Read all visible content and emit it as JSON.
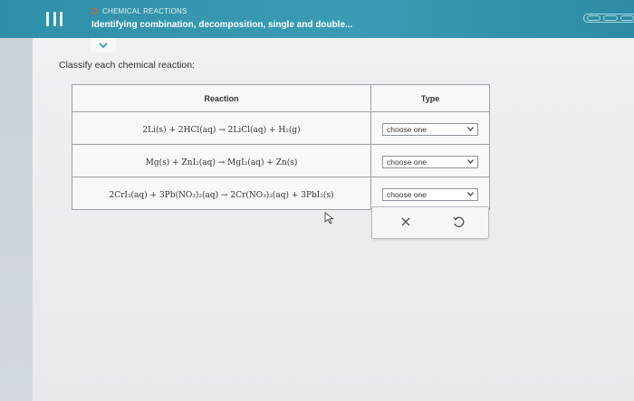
{
  "header": {
    "topic": "CHEMICAL REACTIONS",
    "title": "Identifying combination, decomposition, single and double..."
  },
  "prompt": "Classify each chemical reaction:",
  "table": {
    "headers": {
      "reaction": "Reaction",
      "type": "Type"
    },
    "rows": [
      {
        "reaction": "2Li(s) + 2HCl(aq) → 2LiCl(aq) + H₂(g)",
        "type": "choose one"
      },
      {
        "reaction": "Mg(s) + ZnI₂(aq) → MgI₂(aq) + Zn(s)",
        "type": "choose one"
      },
      {
        "reaction": "2CrI₃(aq) + 3Pb(NO₃)₂(aq) → 2Cr(NO₃)₃(aq) + 3PbI₂(s)",
        "type": "choose one"
      }
    ]
  },
  "actions": {
    "clear_icon": "close-icon",
    "undo_icon": "undo-icon"
  },
  "colors": {
    "header_bg": "#3597b0",
    "topic_dot": "#e85a3a",
    "page_bg": "#eceef1"
  }
}
